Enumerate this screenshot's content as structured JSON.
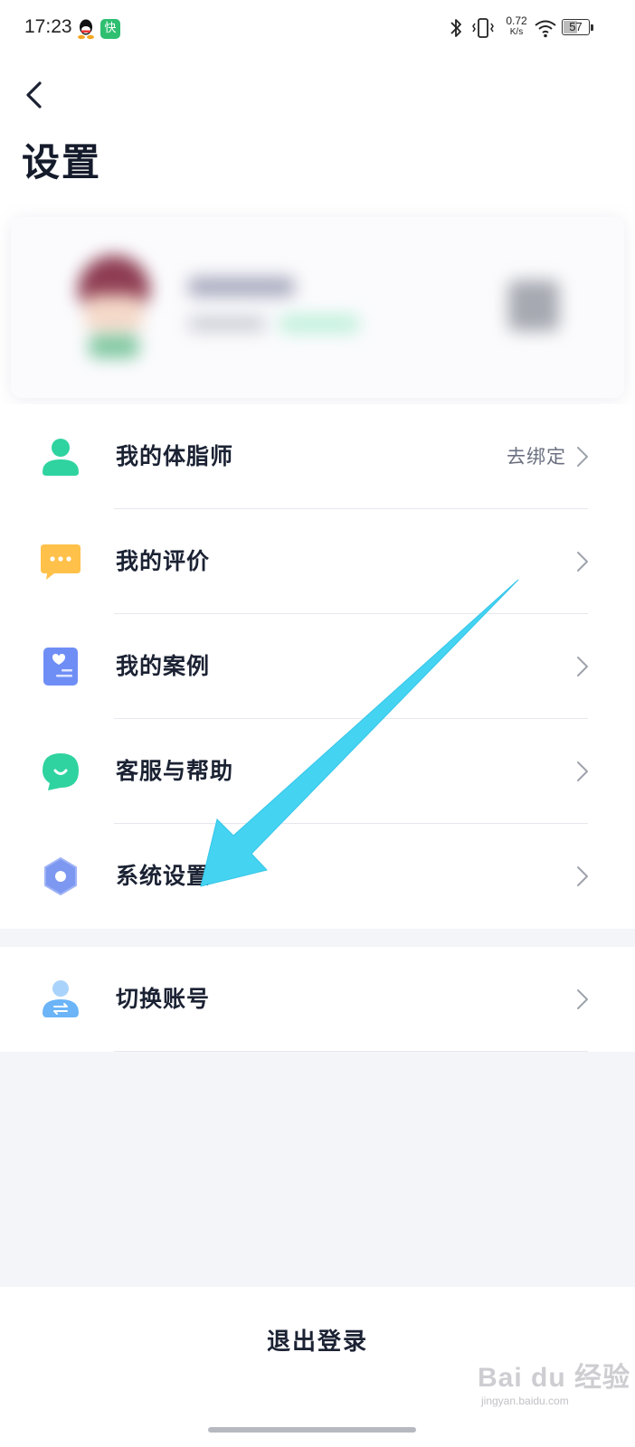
{
  "status_bar": {
    "time": "17:23",
    "app_badge": "快",
    "net_speed_value": "0.72",
    "net_speed_unit": "K/s",
    "battery": "57",
    "battery_level": 0.57
  },
  "header": {
    "title": "设置"
  },
  "menu": {
    "items": [
      {
        "label": "我的体脂师",
        "trailing": "去绑定",
        "icon": "person-icon"
      },
      {
        "label": "我的评价",
        "trailing": "",
        "icon": "chat-bubble-icon"
      },
      {
        "label": "我的案例",
        "trailing": "",
        "icon": "case-document-icon"
      },
      {
        "label": "客服与帮助",
        "trailing": "",
        "icon": "customer-service-icon"
      },
      {
        "label": "系统设置",
        "trailing": "",
        "icon": "hexagon-settings-icon"
      },
      {
        "label": "切换账号",
        "trailing": "",
        "icon": "switch-account-icon"
      }
    ]
  },
  "logout": {
    "label": "退出登录"
  },
  "watermark": {
    "brand": "Bai du 经验",
    "site": "jingyan.baidu.com"
  },
  "colors": {
    "title": "#141b2b",
    "divider": "#e6e8ee",
    "page_bg_grey": "#f4f5f9",
    "arrow": "#45d3f2",
    "person_icon": "#2fd3a0",
    "chat_icon": "#ffc14a",
    "case_icon": "#6f8ef5",
    "service_icon": "#2fd3a0",
    "settings_icon": "#7d98f0",
    "switch_icon": "#6bb4f7"
  }
}
